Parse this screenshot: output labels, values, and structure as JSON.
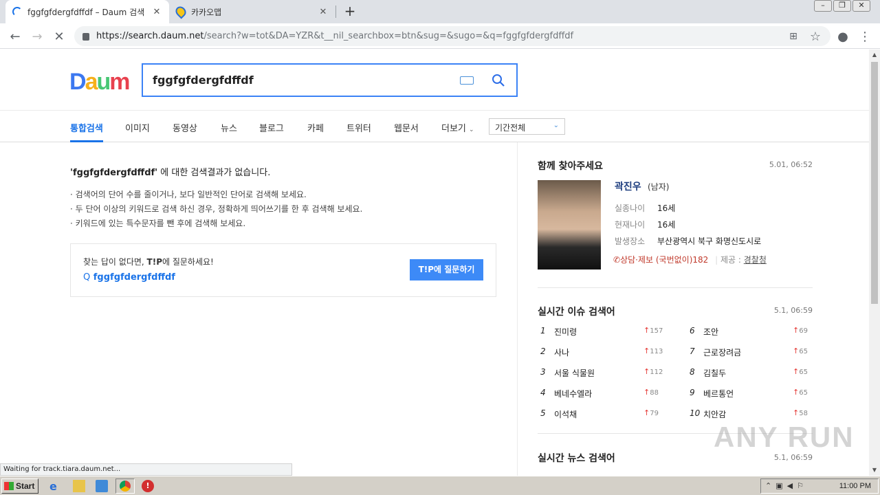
{
  "browser": {
    "tabs": [
      {
        "title": "fggfgfdergfdffdf – Daum 검색",
        "active": true
      },
      {
        "title": "카카오맵",
        "active": false
      }
    ],
    "url_host": "https://search.daum.net",
    "url_path": "/search?w=tot&DA=YZR&t__nil_searchbox=btn&sug=&sugo=&q=fggfgfdergfdffdf"
  },
  "search": {
    "logo": "Daum",
    "query": "fggfgfdergfdffdf"
  },
  "nav": {
    "items": [
      "통합검색",
      "이미지",
      "동영상",
      "뉴스",
      "블로그",
      "카페",
      "트위터",
      "웹문서",
      "더보기"
    ],
    "period": "기간전체"
  },
  "noresult": {
    "query_quoted": "'fggfgfdergfdffdf'",
    "message": " 에 대한 검색결과가 없습니다.",
    "tips": [
      "· 검색어의 단어 수를 줄이거나, 보다 일반적인 단어로 검색해 보세요.",
      "· 두 단어 이상의 키워드로 검색 하신 경우, 정확하게 띄어쓰기를 한 후 검색해 보세요.",
      "· 키워드에 있는 특수문자를 뺀 후에 검색해 보세요."
    ],
    "tip_prompt_prefix": "찾는 답이 없다면, ",
    "tip_brand": "T!P",
    "tip_prompt_suffix": "에 질문하세요!",
    "tip_query": "fggfgfdergfdffdf",
    "tip_button": "T!P에 질문하기"
  },
  "missing": {
    "title": "함께 찾아주세요",
    "time": "5.01, 06:52",
    "name": "곽진우",
    "sex": "(남자)",
    "rows": [
      {
        "label": "실종나이",
        "value": "16세"
      },
      {
        "label": "현재나이",
        "value": "16세"
      },
      {
        "label": "발생장소",
        "value": "부산광역시 북구 화명신도시로"
      }
    ],
    "tel": "상담·제보 (국번없이)182",
    "source_label": "제공 : ",
    "source": "경찰청"
  },
  "realtime_issue": {
    "title": "실시간 이슈 검색어",
    "time": "5.1, 06:59",
    "items": [
      {
        "rank": "1",
        "keyword": "진미령",
        "delta": "157"
      },
      {
        "rank": "2",
        "keyword": "사나",
        "delta": "113"
      },
      {
        "rank": "3",
        "keyword": "서울 식물원",
        "delta": "112"
      },
      {
        "rank": "4",
        "keyword": "베네수엘라",
        "delta": "88"
      },
      {
        "rank": "5",
        "keyword": "이석채",
        "delta": "79"
      },
      {
        "rank": "6",
        "keyword": "조안",
        "delta": "69"
      },
      {
        "rank": "7",
        "keyword": "근로장려금",
        "delta": "65"
      },
      {
        "rank": "8",
        "keyword": "김칠두",
        "delta": "65"
      },
      {
        "rank": "9",
        "keyword": "베르통언",
        "delta": "65"
      },
      {
        "rank": "10",
        "keyword": "치안감",
        "delta": "58"
      }
    ]
  },
  "realtime_news": {
    "title": "실시간 뉴스 검색어",
    "time": "5.1, 06:59"
  },
  "status_text": "Waiting for track.tiara.daum.net...",
  "watermark": "ANY RUN",
  "taskbar": {
    "start": "Start",
    "clock": "11:00 PM"
  },
  "colors": {
    "accent": "#1a73e8",
    "tip_button": "#3d8af7",
    "up_arrow": "#e53935"
  }
}
